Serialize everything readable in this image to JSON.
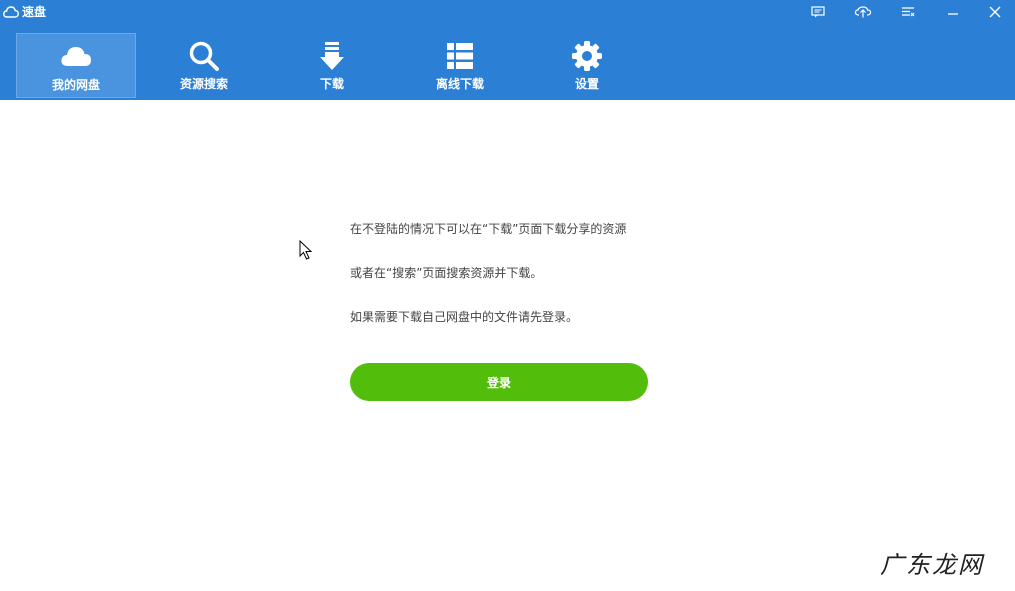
{
  "window": {
    "title": "速盘",
    "controls": [
      {
        "name": "feedback-icon"
      },
      {
        "name": "skin-icon"
      },
      {
        "name": "menu-icon"
      },
      {
        "name": "minimize-icon"
      },
      {
        "name": "close-icon"
      }
    ]
  },
  "toolbar": {
    "items": [
      {
        "label": "我的网盘",
        "icon": "cloud-icon",
        "active": true
      },
      {
        "label": "资源搜索",
        "icon": "search-icon",
        "active": false
      },
      {
        "label": "下载",
        "icon": "download-icon",
        "active": false
      },
      {
        "label": "离线下载",
        "icon": "list-icon",
        "active": false
      },
      {
        "label": "设置",
        "icon": "gear-icon",
        "active": false
      }
    ]
  },
  "main": {
    "messages": [
      "在不登陆的情况下可以在“下载”页面下载分享的资源",
      "或者在“搜索”页面搜索资源并下载。",
      "如果需要下载自己网盘中的文件请先登录。"
    ],
    "login_label": "登录"
  },
  "colors": {
    "header": "#2b7fd4",
    "active_tab": "#4a93de",
    "login_button": "#52bd0b",
    "background": "#ffffff"
  },
  "watermark": "广东龙网"
}
